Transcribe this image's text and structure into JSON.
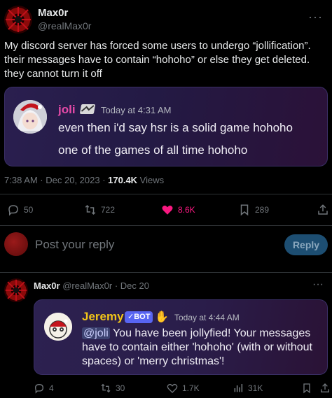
{
  "tweet": {
    "author_name": "Max0r",
    "author_handle": "@realMax0r",
    "text": "My discord server has forced some users to undergo “jollification”. their messages have to contain “hohoho” or else they get deleted. they cannot turn it off",
    "embed": {
      "user": "joli",
      "timestamp": "Today at 4:31 AM",
      "line1": "even then i'd say hsr is a solid game hohoho",
      "line2": "one of the games of all time hohoho"
    },
    "meta_time": "7:38 AM · Dec 20, 2023 · ",
    "views_count": "170.4K",
    "views_label": " Views",
    "stats": {
      "replies": "50",
      "retweets": "722",
      "likes": "8.6K",
      "bookmarks": "289"
    }
  },
  "reply_box": {
    "placeholder": "Post your reply",
    "button_label": "Reply"
  },
  "reply": {
    "author_name": "Max0r",
    "author_handle": "@realMax0r",
    "date": "· Dec 20",
    "embed": {
      "user": "Jeremy",
      "bot_badge": "✓BOT",
      "timestamp": "Today at 4:44 AM",
      "mention": "@joli",
      "text_rest": " You have been jollyfied! Your messages have to contain either 'hohoho' (with or without spaces) or 'merry christmas'!"
    },
    "stats": {
      "replies": "4",
      "retweets": "30",
      "likes": "1.7K",
      "views": "31K"
    }
  },
  "colors": {
    "like_active": "#f91880",
    "reply_button_bg": "#1d4e72",
    "joli_name": "#e64aa8",
    "jeremy_name": "#f0c419",
    "bot_badge": "#5865f2",
    "mention_bg": "#3c4270"
  }
}
